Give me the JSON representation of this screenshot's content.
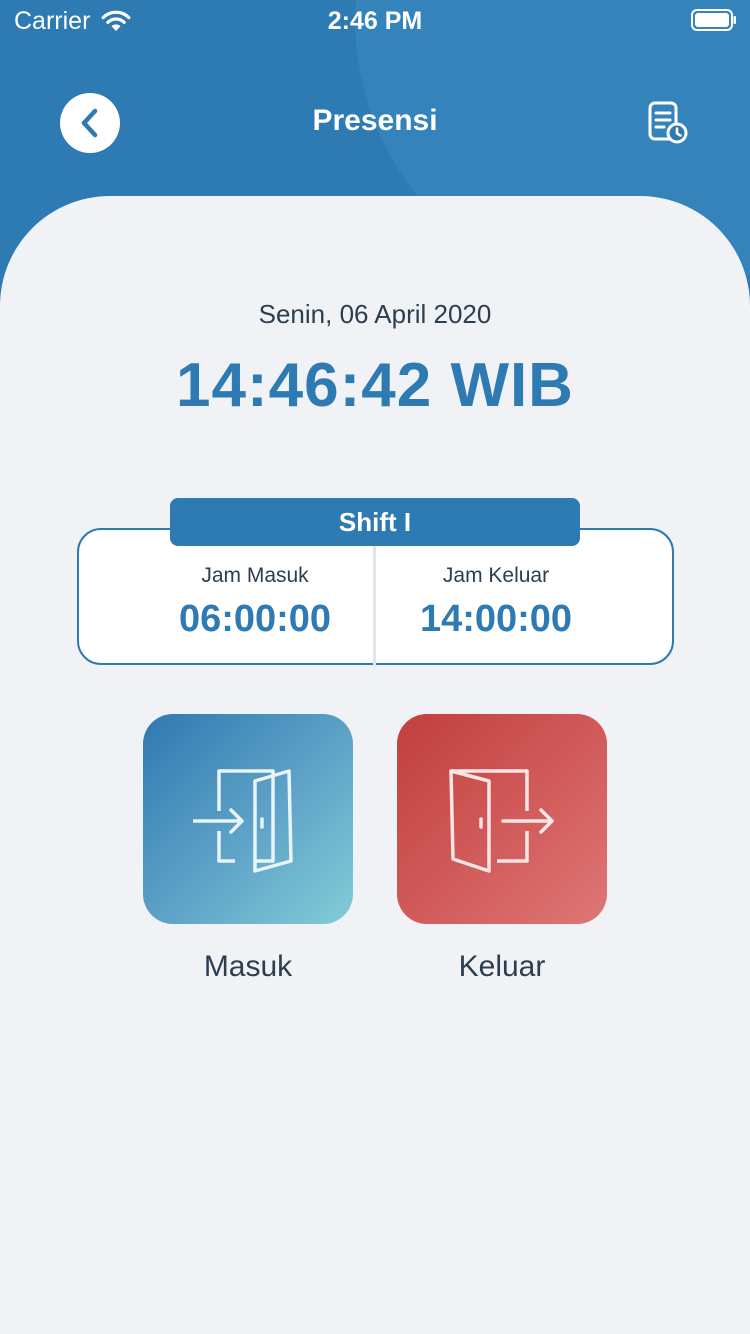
{
  "status_bar": {
    "carrier": "Carrier",
    "time": "2:46 PM"
  },
  "nav": {
    "title": "Presensi",
    "back_icon": "chevron-left-icon",
    "history_icon": "document-history-icon"
  },
  "clock": {
    "date": "Senin, 06 April 2020",
    "time": "14:46:42 WIB"
  },
  "shift": {
    "name": "Shift I",
    "check_in_label": "Jam Masuk",
    "check_in_time": "06:00:00",
    "check_out_label": "Jam Keluar",
    "check_out_time": "14:00:00"
  },
  "actions": {
    "check_in_label": "Masuk",
    "check_out_label": "Keluar",
    "check_in_icon": "door-enter-icon",
    "check_out_icon": "door-exit-icon"
  },
  "colors": {
    "primary": "#2e7ab3",
    "danger": "#c0403d",
    "background": "#f0f2f6"
  }
}
